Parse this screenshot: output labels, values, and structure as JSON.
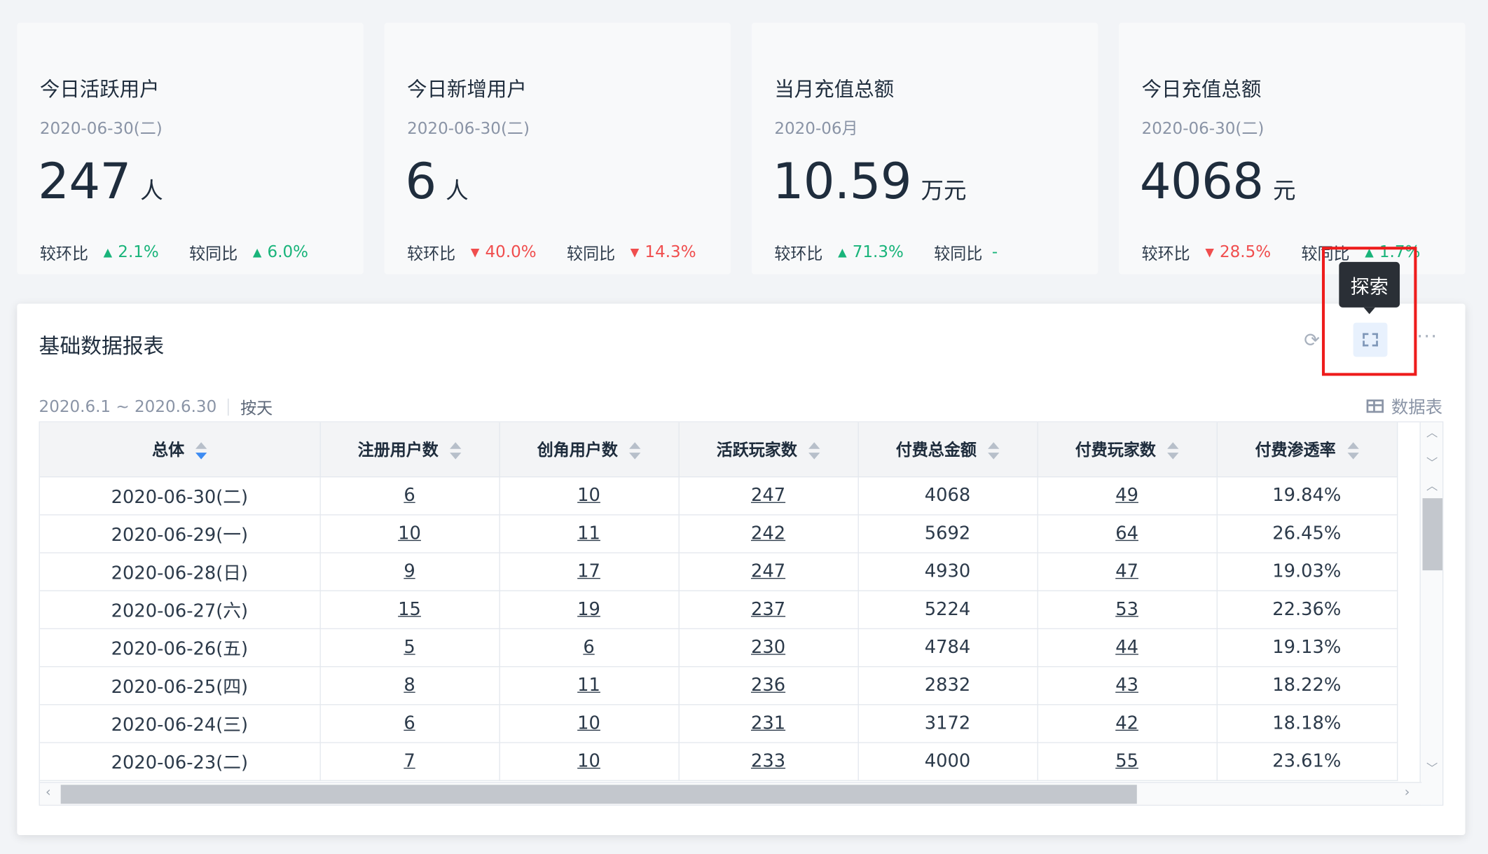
{
  "cards": [
    {
      "title": "今日活跃用户",
      "date": "2020-06-30(二)",
      "value": "247",
      "unit": "人",
      "mom_label": "较环比",
      "mom_dir": "up",
      "mom_value": "2.1%",
      "yoy_label": "较同比",
      "yoy_dir": "up",
      "yoy_value": "6.0%"
    },
    {
      "title": "今日新增用户",
      "date": "2020-06-30(二)",
      "value": "6",
      "unit": "人",
      "mom_label": "较环比",
      "mom_dir": "down",
      "mom_value": "40.0%",
      "yoy_label": "较同比",
      "yoy_dir": "down",
      "yoy_value": "14.3%"
    },
    {
      "title": "当月充值总额",
      "date": "2020-06月",
      "value": "10.59",
      "unit": "万元",
      "mom_label": "较环比",
      "mom_dir": "up",
      "mom_value": "71.3%",
      "yoy_label": "较同比",
      "yoy_dir": "none",
      "yoy_value": "-"
    },
    {
      "title": "今日充值总额",
      "date": "2020-06-30(二)",
      "value": "4068",
      "unit": "元",
      "mom_label": "较环比",
      "mom_dir": "down",
      "mom_value": "28.5%",
      "yoy_label": "较同比",
      "yoy_dir": "up",
      "yoy_value": "1.7%"
    }
  ],
  "panel": {
    "title": "基础数据报表",
    "tooltip": "探索",
    "more": "···",
    "date_range": "2020.6.1 ~ 2020.6.30",
    "granularity": "按天",
    "datatable_label": "数据表"
  },
  "table": {
    "headers": [
      "总体",
      "注册用户数",
      "创角用户数",
      "活跃玩家数",
      "付费总金额",
      "付费玩家数",
      "付费渗透率"
    ],
    "rows": [
      [
        "2020-06-30(二)",
        "6",
        "10",
        "247",
        "4068",
        "49",
        "19.84%"
      ],
      [
        "2020-06-29(一)",
        "10",
        "11",
        "242",
        "5692",
        "64",
        "26.45%"
      ],
      [
        "2020-06-28(日)",
        "9",
        "17",
        "247",
        "4930",
        "47",
        "19.03%"
      ],
      [
        "2020-06-27(六)",
        "15",
        "19",
        "237",
        "5224",
        "53",
        "22.36%"
      ],
      [
        "2020-06-26(五)",
        "5",
        "6",
        "230",
        "4784",
        "44",
        "19.13%"
      ],
      [
        "2020-06-25(四)",
        "8",
        "11",
        "236",
        "2832",
        "43",
        "18.22%"
      ],
      [
        "2020-06-24(三)",
        "6",
        "10",
        "231",
        "3172",
        "42",
        "18.18%"
      ],
      [
        "2020-06-23(二)",
        "7",
        "10",
        "233",
        "4000",
        "55",
        "23.61%"
      ]
    ]
  },
  "colors": {
    "up": "#19b47a",
    "down": "#f04e4e",
    "highlight": "#ee1c1c",
    "sort_active": "#3d8bf2"
  }
}
